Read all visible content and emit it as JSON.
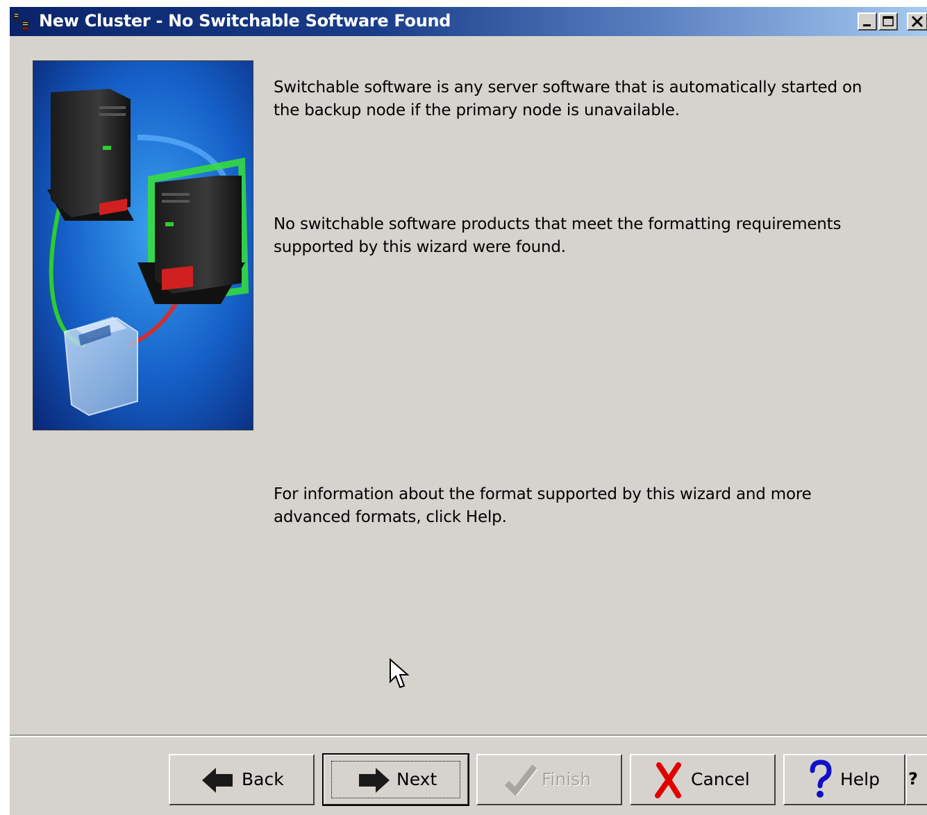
{
  "window": {
    "title": "New Cluster - No Switchable Software Found"
  },
  "content": {
    "paragraph1": "Switchable software is any server software that is automatically started on the backup node if the primary node is unavailable.",
    "paragraph2": "No switchable software products that meet the formatting requirements supported by this wizard were found.",
    "paragraph3": "For information about the format supported by this wizard and more advanced formats, click Help."
  },
  "buttons": {
    "back": "Back",
    "next": "Next",
    "finish": "Finish",
    "cancel": "Cancel",
    "help": "Help",
    "whats_this": "?"
  },
  "colors": {
    "titlebar_start": "#0a246a",
    "titlebar_end": "#a6caf0",
    "dialog_bg": "#d6d3ce",
    "cancel_icon": "#e00000",
    "help_icon": "#1010c8"
  }
}
